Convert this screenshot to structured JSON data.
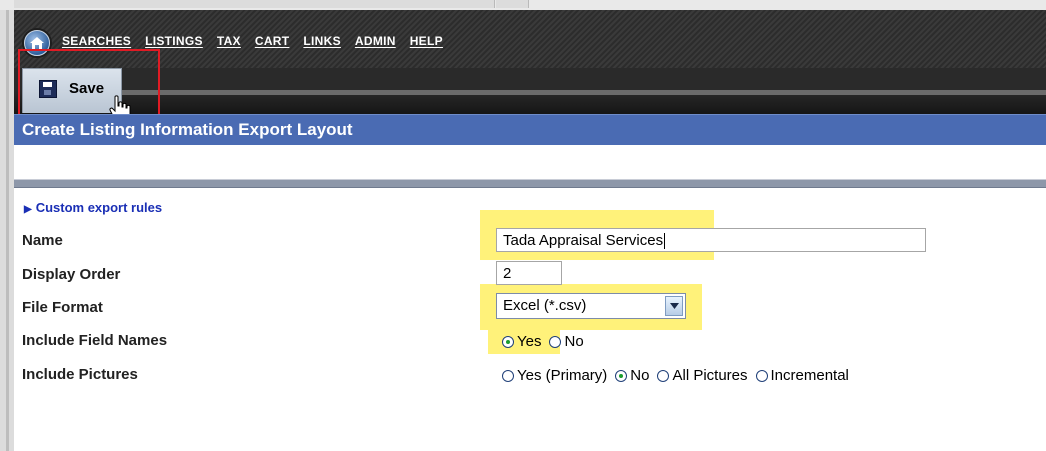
{
  "nav": {
    "items": [
      {
        "label": "Searches"
      },
      {
        "label": "Listings"
      },
      {
        "label": "Tax"
      },
      {
        "label": "Cart"
      },
      {
        "label": "Links"
      },
      {
        "label": "Admin"
      },
      {
        "label": "Help"
      }
    ]
  },
  "toolbar": {
    "save_label": "Save"
  },
  "page": {
    "title": "Create Listing Information Export Layout",
    "custom_rules_link": "Custom export rules"
  },
  "form": {
    "name": {
      "label": "Name",
      "value": "Tada Appraisal Services"
    },
    "display_order": {
      "label": "Display Order",
      "value": "2"
    },
    "file_format": {
      "label": "File Format",
      "selected": "Excel (*.csv)"
    },
    "include_field_names": {
      "label": "Include Field Names",
      "options": [
        {
          "label": "Yes",
          "checked": true
        },
        {
          "label": "No",
          "checked": false
        }
      ]
    },
    "include_pictures": {
      "label": "Include Pictures",
      "options": [
        {
          "label": "Yes (Primary)",
          "checked": false
        },
        {
          "label": "No",
          "checked": true
        },
        {
          "label": "All Pictures",
          "checked": false
        },
        {
          "label": "Incremental",
          "checked": false
        }
      ]
    }
  },
  "colors": {
    "title_bar": "#4a6bb3",
    "highlight": "#fff27a",
    "annotation_box": "#e01b24",
    "link": "#1a2fb5"
  }
}
